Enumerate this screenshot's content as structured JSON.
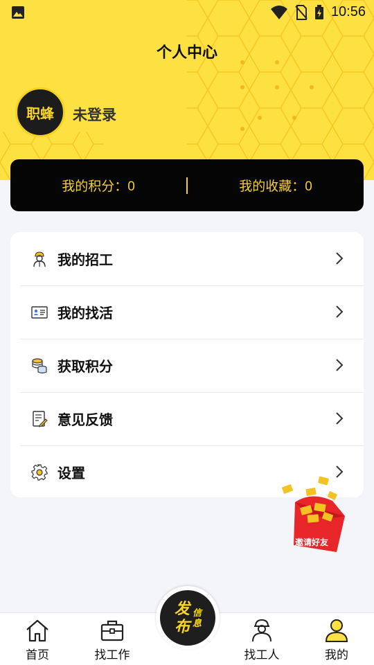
{
  "status_bar": {
    "time": "10:56"
  },
  "header": {
    "title": "个人中心",
    "avatar_text": "职蜂",
    "login_status": "未登录"
  },
  "stats": {
    "points": "我的积分：0",
    "favorites": "我的收藏：0"
  },
  "menu": {
    "items": [
      {
        "label": "我的招工",
        "icon": "worker-icon"
      },
      {
        "label": "我的找活",
        "icon": "id-card-icon"
      },
      {
        "label": "获取积分",
        "icon": "coins-icon"
      },
      {
        "label": "意见反馈",
        "icon": "feedback-icon"
      },
      {
        "label": "设置",
        "icon": "gear-icon"
      }
    ]
  },
  "promo": {
    "label": "邀请好友"
  },
  "publish": {
    "main": "发布",
    "sub": "信息"
  },
  "tabbar": {
    "tabs": [
      {
        "label": "首页",
        "icon": "home-icon"
      },
      {
        "label": "找工作",
        "icon": "briefcase-icon"
      },
      {
        "label": "找工人",
        "icon": "worker-icon"
      },
      {
        "label": "我的",
        "icon": "user-icon",
        "active": true
      }
    ]
  },
  "colors": {
    "brand_yellow": "#fde142",
    "stats_text": "#f6cf2a",
    "dark": "#050505"
  }
}
